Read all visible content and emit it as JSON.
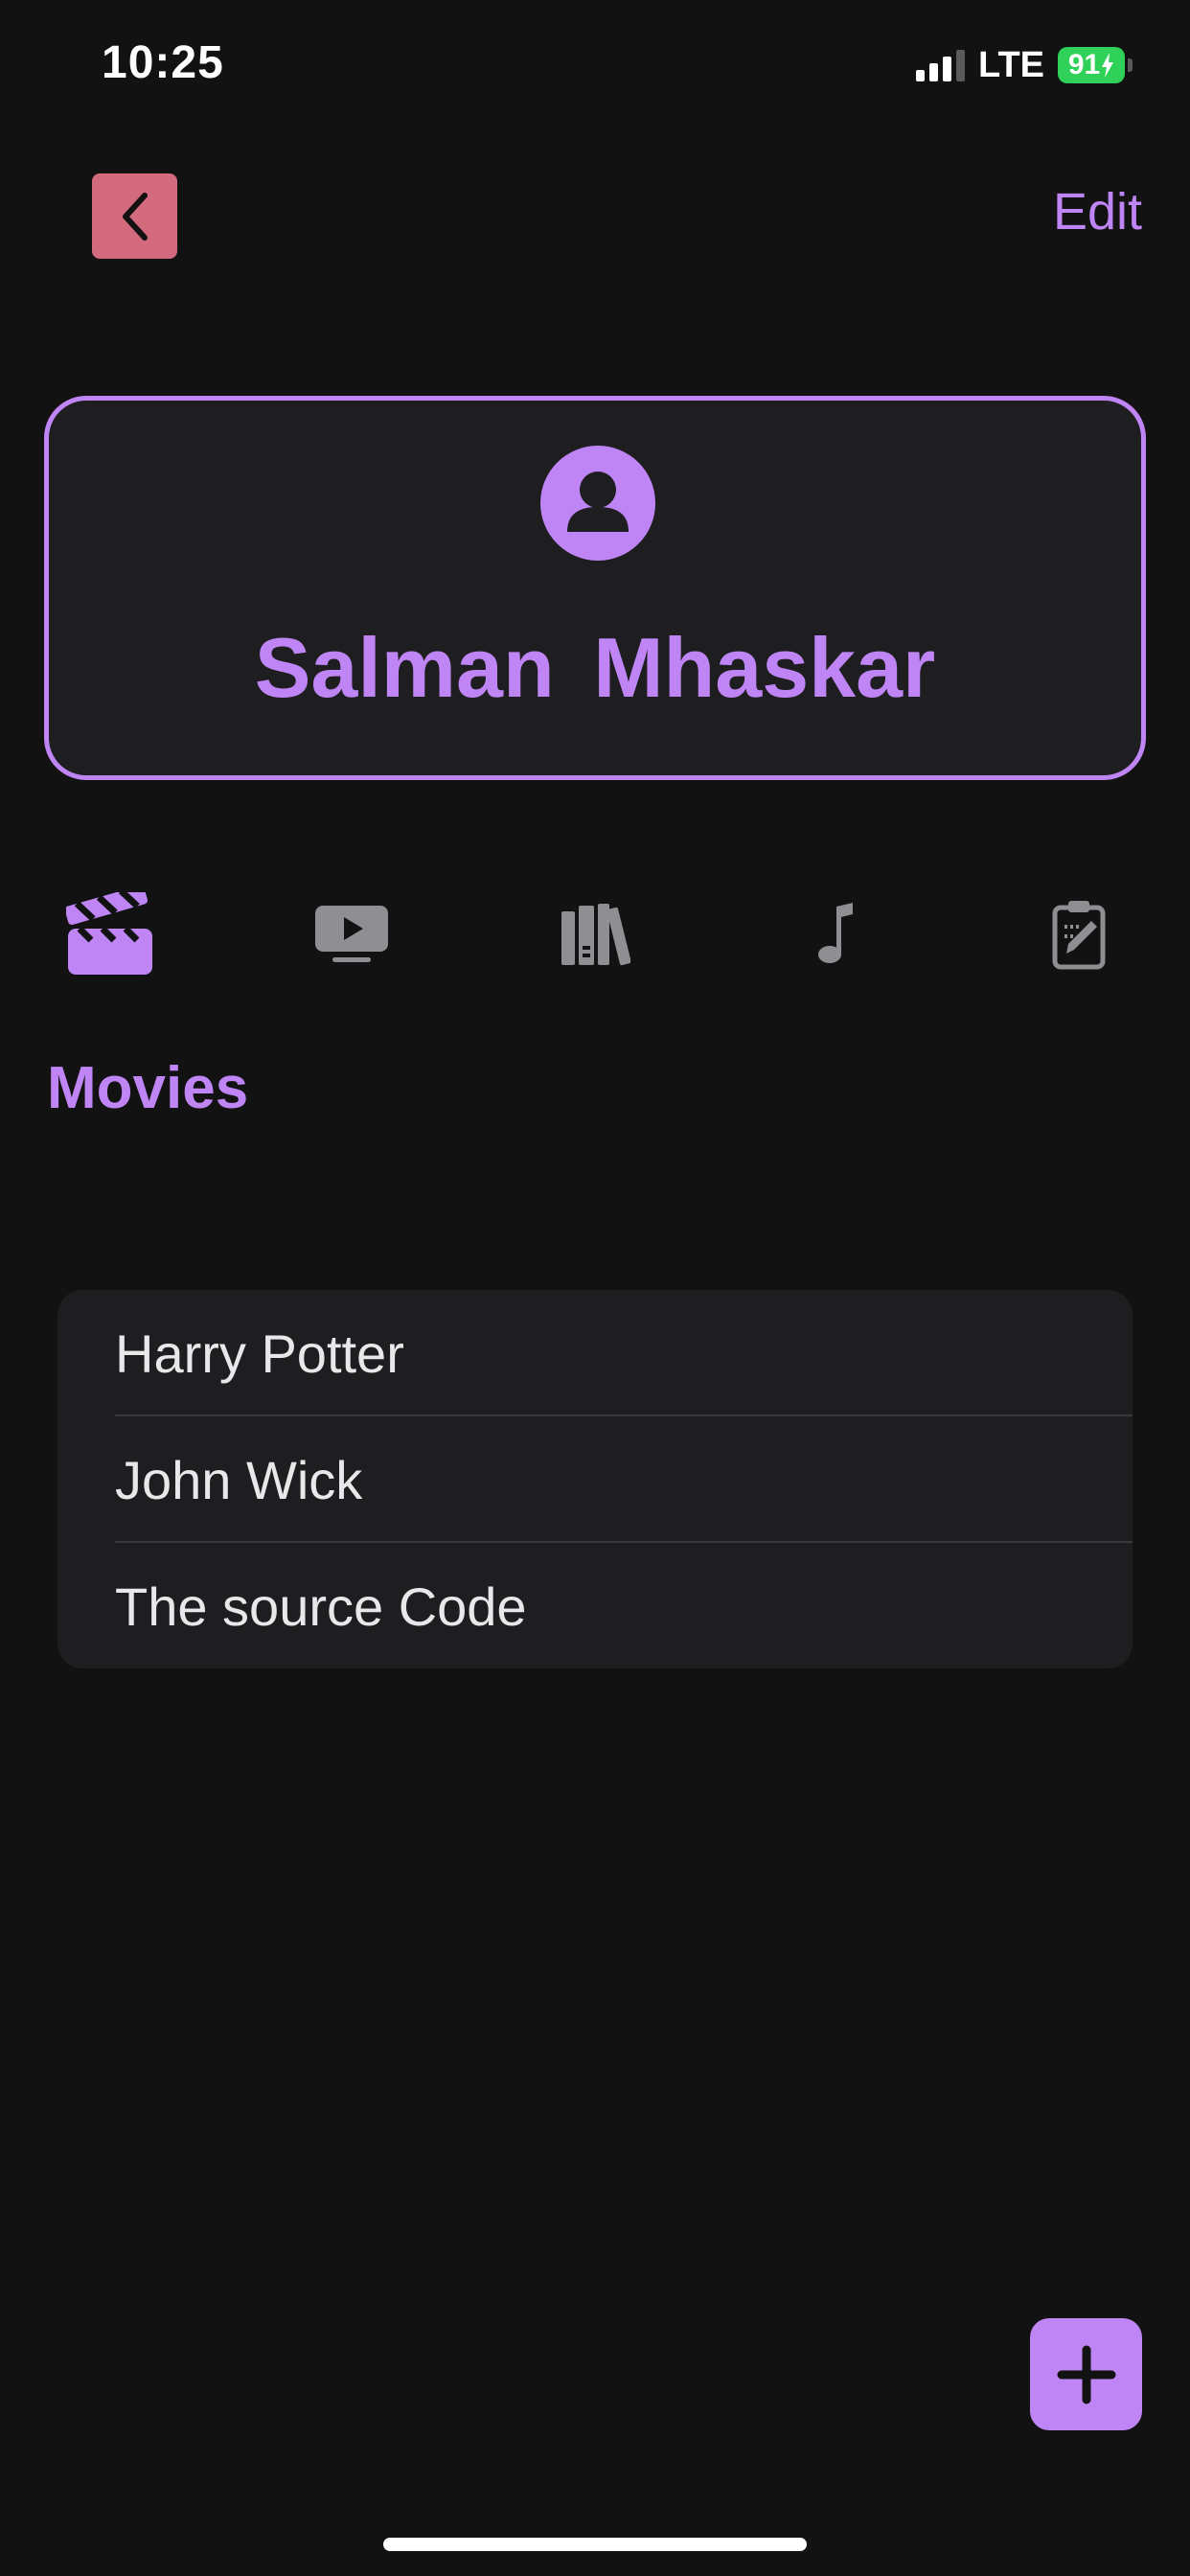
{
  "status_bar": {
    "time": "10:25",
    "network": "LTE",
    "battery_level": "91"
  },
  "nav": {
    "back_icon": "chevron-left-icon",
    "edit_label": "Edit"
  },
  "profile": {
    "avatar_icon": "person-icon",
    "name": "Salman  Mhaskar"
  },
  "tabs": [
    {
      "icon": "clapperboard-icon",
      "selected": true
    },
    {
      "icon": "tv-play-icon",
      "selected": false
    },
    {
      "icon": "books-icon",
      "selected": false
    },
    {
      "icon": "music-note-icon",
      "selected": false
    },
    {
      "icon": "clipboard-edit-icon",
      "selected": false
    }
  ],
  "section": {
    "title": "Movies"
  },
  "movies": [
    {
      "title": "Harry Potter"
    },
    {
      "title": "John Wick"
    },
    {
      "title": "The source Code"
    }
  ],
  "fab": {
    "icon": "plus-icon"
  },
  "colors": {
    "accent": "#bf85f5",
    "back_button": "#d46a7e",
    "inactive_icon": "#8e8e93",
    "background": "#121212",
    "card": "#1e1e20",
    "battery": "#30d158"
  }
}
